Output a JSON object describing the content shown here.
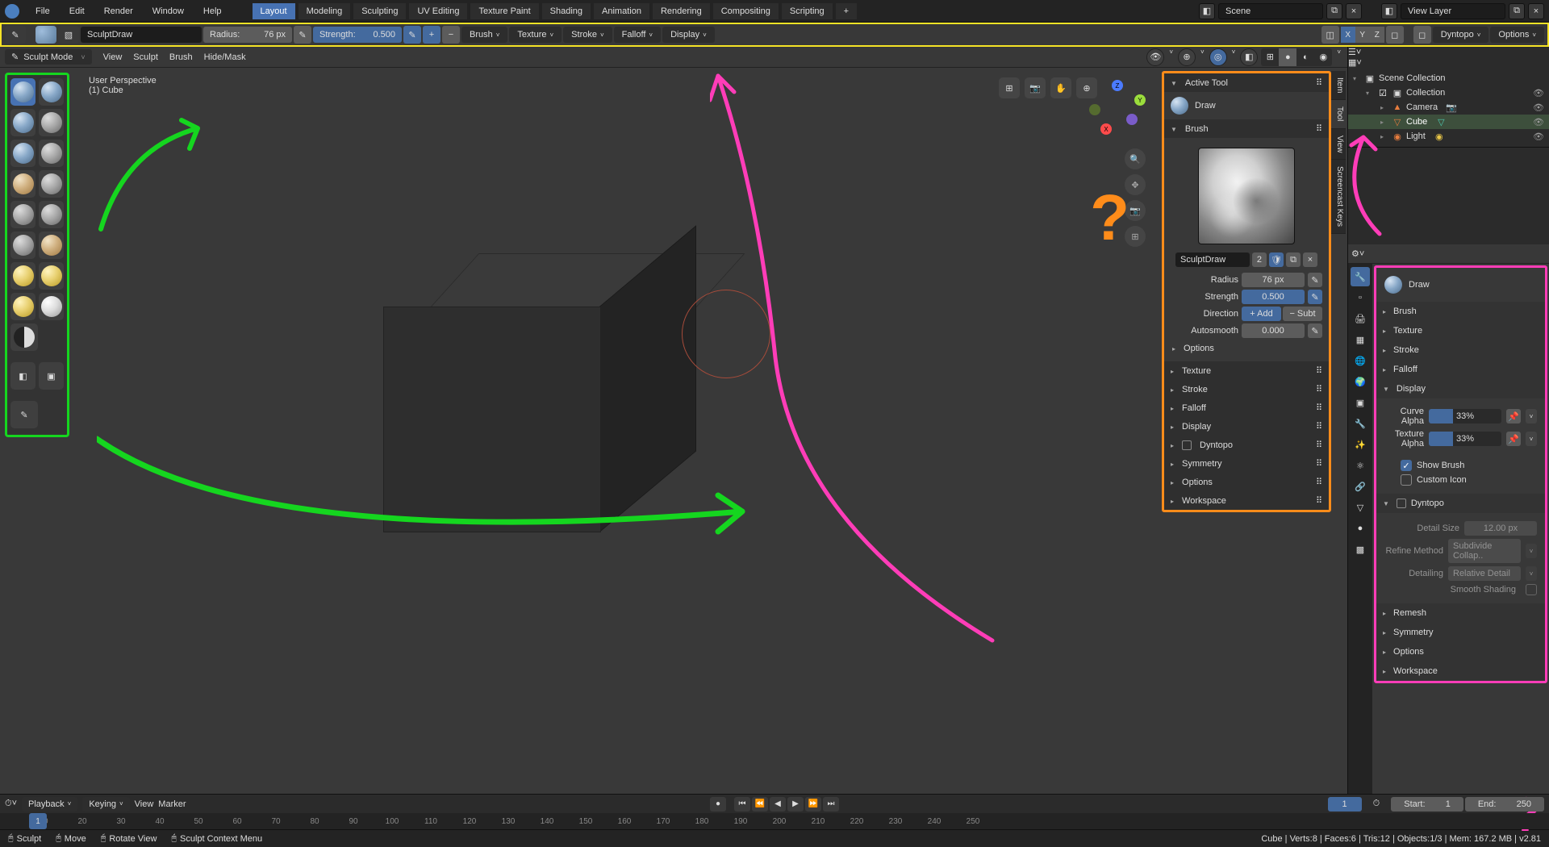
{
  "top_menu": [
    "File",
    "Edit",
    "Render",
    "Window",
    "Help"
  ],
  "workspaces": [
    "Layout",
    "Modeling",
    "Sculpting",
    "UV Editing",
    "Texture Paint",
    "Shading",
    "Animation",
    "Rendering",
    "Compositing",
    "Scripting"
  ],
  "active_workspace": "Layout",
  "scene_name": "Scene",
  "view_layer": "View Layer",
  "tool_header": {
    "brush_name": "SculptDraw",
    "radius_label": "Radius:",
    "radius_value": "76 px",
    "strength_label": "Strength:",
    "strength_value": "0.500",
    "dropdowns": [
      "Brush",
      "Texture",
      "Stroke",
      "Falloff",
      "Display"
    ],
    "xyz": {
      "x": true,
      "y": false,
      "z": false
    },
    "dyntopo": "Dyntopo",
    "options": "Options"
  },
  "viewport_header": {
    "mode": "Sculpt Mode",
    "menus": [
      "View",
      "Sculpt",
      "Brush",
      "Hide/Mask"
    ]
  },
  "viewport_info": {
    "line1": "User Perspective",
    "line2": "(1) Cube"
  },
  "npanel": {
    "active_tool_title": "Active Tool",
    "tool_name": "Draw",
    "brush_title": "Brush",
    "brush_name": "SculptDraw",
    "brush_users": "2",
    "radius_label": "Radius",
    "radius_value": "76 px",
    "strength_label": "Strength",
    "strength_value": "0.500",
    "direction_label": "Direction",
    "dir_add": "+ Add",
    "dir_sub": "− Subt",
    "autosmooth_label": "Autosmooth",
    "autosmooth_value": "0.000",
    "sections": [
      "Options",
      "Texture",
      "Stroke",
      "Falloff",
      "Display",
      "Dyntopo",
      "Symmetry",
      "Options",
      "Workspace"
    ],
    "vtabs": [
      "Item",
      "Tool",
      "View",
      "Screencast Keys"
    ]
  },
  "outliner": {
    "collection_root": "Scene Collection",
    "collection": "Collection",
    "camera": "Camera",
    "cube": "Cube",
    "light": "Light"
  },
  "props": {
    "tool_name": "Draw",
    "sections_collapsed": [
      "Brush",
      "Texture",
      "Stroke",
      "Falloff"
    ],
    "display_title": "Display",
    "curve_alpha_label": "Curve Alpha",
    "curve_alpha_value": "33%",
    "texture_alpha_label": "Texture Alpha",
    "texture_alpha_value": "33%",
    "show_brush": "Show Brush",
    "custom_icon": "Custom Icon",
    "dyntopo_title": "Dyntopo",
    "detail_size_label": "Detail Size",
    "detail_size_value": "12.00 px",
    "refine_label": "Refine Method",
    "refine_value": "Subdivide Collap..",
    "detailing_label": "Detailing",
    "detailing_value": "Relative Detail",
    "smooth_shading": "Smooth Shading",
    "remesh_title": "Remesh",
    "symmetry_title": "Symmetry",
    "options_title": "Options",
    "workspace_title": "Workspace"
  },
  "timeline": {
    "dropmenus": [
      "Playback",
      "Keying",
      "View",
      "Marker"
    ],
    "current": "1",
    "start_label": "Start:",
    "start_value": "1",
    "end_label": "End:",
    "end_value": "250",
    "ticks": [
      "1",
      "10",
      "20",
      "30",
      "40",
      "50",
      "60",
      "70",
      "80",
      "90",
      "100",
      "110",
      "120",
      "130",
      "140",
      "150",
      "160",
      "170",
      "180",
      "190",
      "200",
      "210",
      "220",
      "230",
      "240",
      "250"
    ]
  },
  "status": {
    "sculpt": "Sculpt",
    "move": "Move",
    "rotate": "Rotate View",
    "context": "Sculpt Context Menu",
    "right": "Cube | Verts:8 | Faces:6 | Tris:12 | Objects:1/3 | Mem: 167.2 MB | v2.81"
  }
}
